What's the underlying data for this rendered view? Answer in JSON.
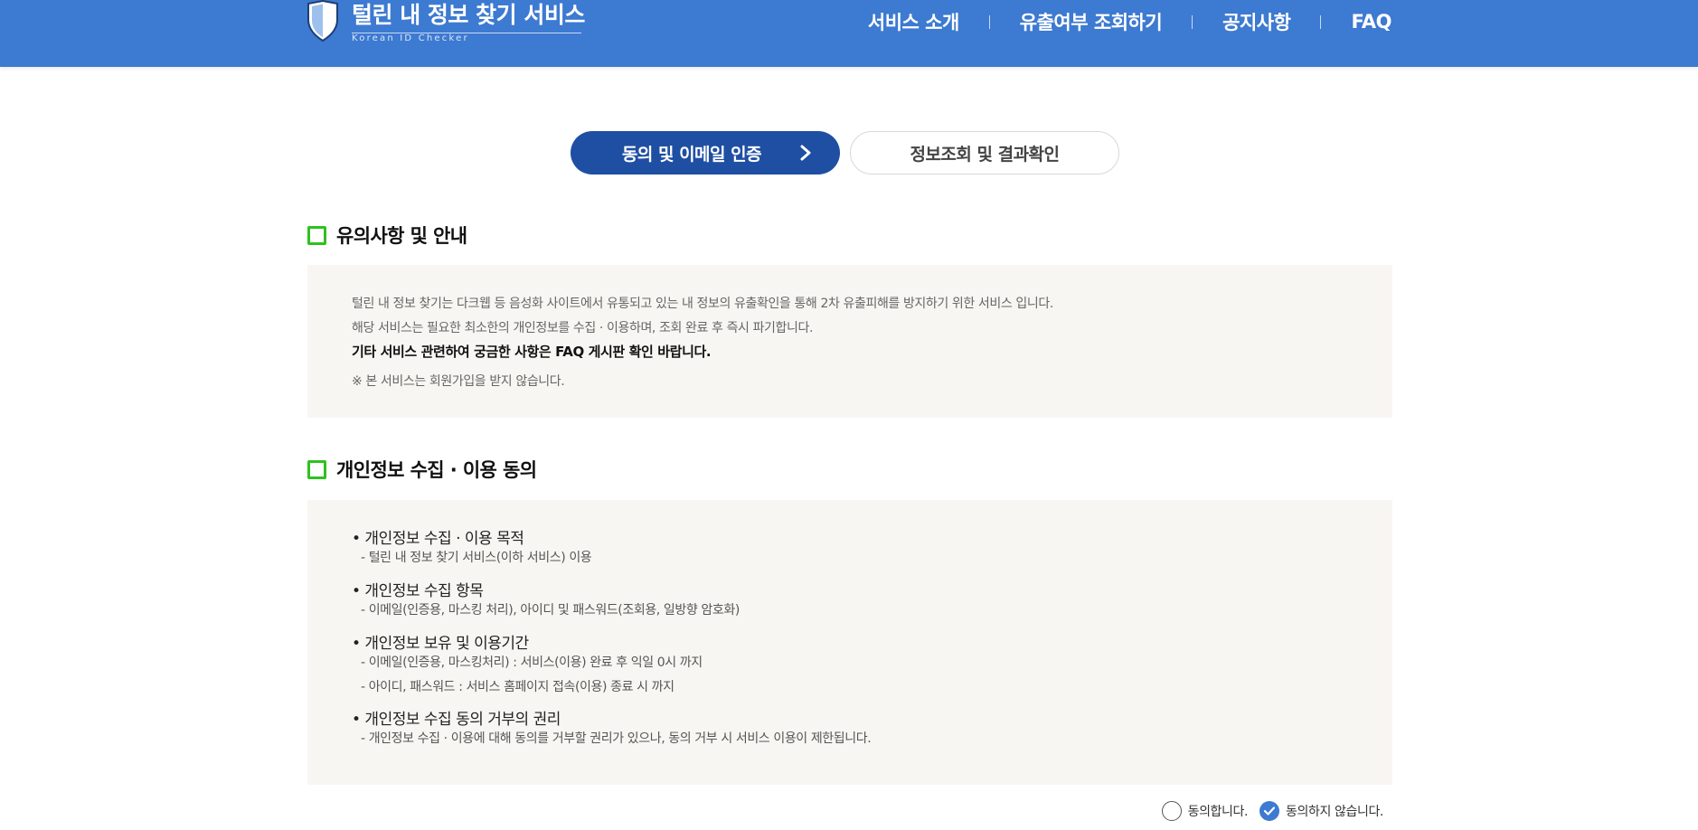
{
  "header": {
    "logo_title": "털린 내 정보 찾기 서비스",
    "logo_subtitle": "Korean ID Checker",
    "nav": [
      {
        "label": "서비스 소개"
      },
      {
        "label": "유출여부 조회하기"
      },
      {
        "label": "공지사항"
      },
      {
        "label": "FAQ"
      }
    ],
    "bg_color": "#3d7ad1"
  },
  "steps": {
    "active": "동의 및 이메일 인증",
    "inactive": "정보조회 및 결과확인",
    "active_color": "#1f4fa3"
  },
  "notice": {
    "title": "유의사항 및 안내",
    "lines": [
      "털린 내 정보 찾기는 다크웹 등 음성화 사이트에서 유통되고 있는 내 정보의 유출확인을 통해 2차 유출피해를 방지하기 위한 서비스 입니다.",
      "해당 서비스는 필요한 최소한의 개인정보를 수집 · 이용하며, 조회 완료 후 즉시 파기합니다.",
      "기타 서비스 관련하여 궁금한 사항은 FAQ 게시판 확인 바랍니다.",
      "※ 본 서비스는 회원가입을 받지 않습니다."
    ]
  },
  "consent": {
    "title": "개인정보 수집 · 이용 동의",
    "items": [
      {
        "heading": "• 개인정보 수집 · 이용 목적",
        "details": [
          "- 털린 내 정보 찾기 서비스(이하 서비스) 이용"
        ]
      },
      {
        "heading": "• 개인정보 수집 항목",
        "details": [
          "- 이메일(인증용, 마스킹 처리), 아이디 및 패스워드(조회용, 일방향 암호화)"
        ]
      },
      {
        "heading": "• 개인정보 보유 및 이용기간",
        "details": [
          "- 이메일(인증용, 마스킹처리) : 서비스(이용) 완료 후 익일 0시 까지",
          "- 아이디, 패스워드 : 서비스 홈페이지 접속(이용) 종료 시 까지"
        ]
      },
      {
        "heading": "• 개인정보 수집 동의 거부의 권리",
        "details": [
          "- 개인정보 수집 · 이용에 대해 동의를 거부할 권리가 있으나, 동의 거부 시 서비스 이용이 제한됩니다."
        ]
      }
    ],
    "agree_label": "동의합니다.",
    "disagree_label": "동의하지 않습니다.",
    "selected": "disagree"
  },
  "accent_green": "#2dc21d",
  "panel_bg": "#f8f6f2"
}
